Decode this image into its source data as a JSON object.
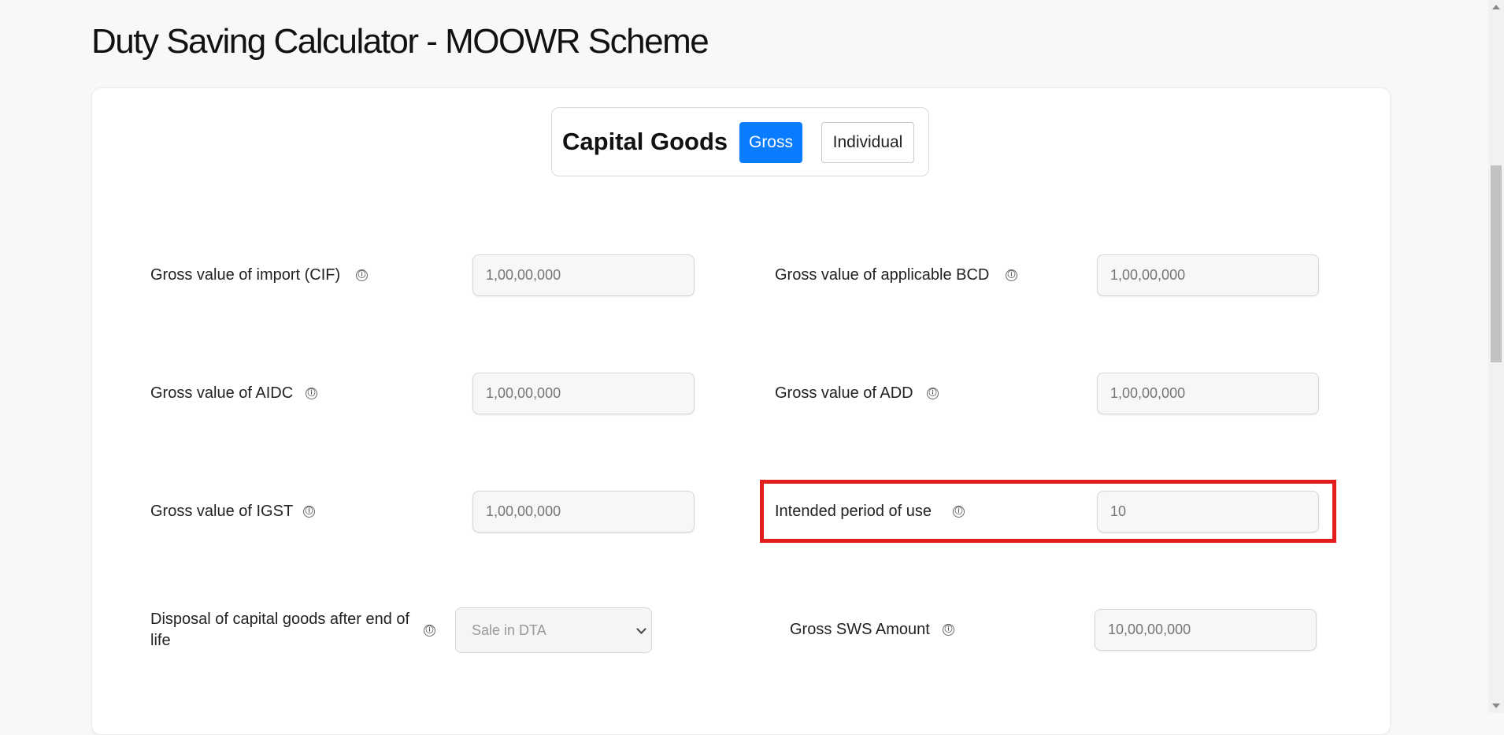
{
  "page": {
    "title": "Duty Saving Calculator - MOOWR Scheme"
  },
  "toggle": {
    "title": "Capital Goods",
    "options": [
      "Gross",
      "Individual"
    ],
    "selected": "Gross"
  },
  "form": {
    "gross_import_cif": {
      "label": "Gross value of import (CIF)",
      "placeholder": "1,00,00,000"
    },
    "gross_bcd": {
      "label": "Gross value of applicable BCD",
      "placeholder": "1,00,00,000"
    },
    "gross_aidc": {
      "label": "Gross value of AIDC",
      "placeholder": "1,00,00,000"
    },
    "gross_add": {
      "label": "Gross value of ADD",
      "placeholder": "1,00,00,000"
    },
    "gross_igst": {
      "label": "Gross value of IGST",
      "placeholder": "1,00,00,000"
    },
    "intended_period": {
      "label": "Intended period of use",
      "placeholder": "10"
    },
    "disposal": {
      "label": "Disposal of capital goods after end of life",
      "selected": "Sale in DTA"
    },
    "gross_sws": {
      "label": "Gross SWS Amount",
      "placeholder": "10,00,00,000"
    }
  },
  "icons": {
    "info": "ⓘ"
  },
  "colors": {
    "accent": "#0a7cff",
    "highlight": "#e11c1c"
  }
}
